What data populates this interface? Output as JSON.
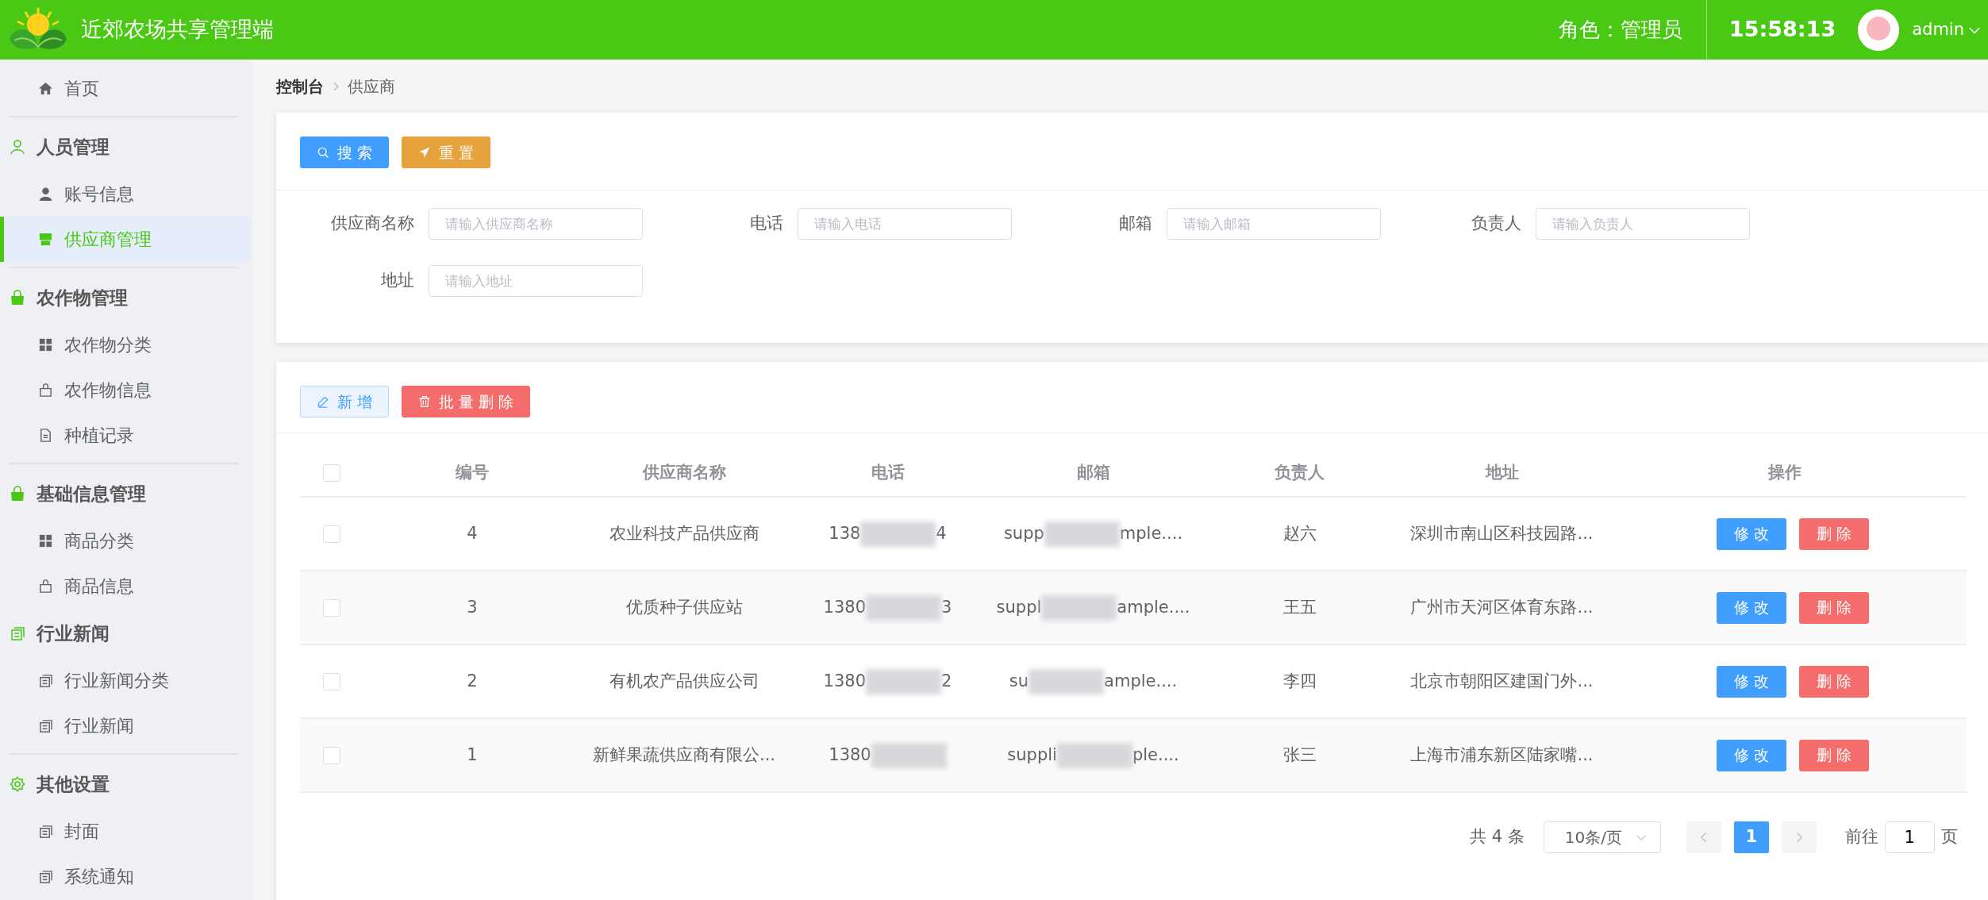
{
  "header": {
    "title": "近郊农场共享管理端",
    "role": "角色：管理员",
    "time": "15:58:13",
    "user": "admin"
  },
  "sidebar": {
    "entries": [
      {
        "kind": "link",
        "label": "首页",
        "selected": false
      },
      {
        "kind": "divider"
      },
      {
        "kind": "group",
        "label": "人员管理"
      },
      {
        "kind": "link",
        "label": "账号信息",
        "selected": false
      },
      {
        "kind": "link",
        "label": "供应商管理",
        "selected": true
      },
      {
        "kind": "divider"
      },
      {
        "kind": "group",
        "label": "农作物管理"
      },
      {
        "kind": "link",
        "label": "农作物分类",
        "selected": false
      },
      {
        "kind": "link",
        "label": "农作物信息",
        "selected": false
      },
      {
        "kind": "link",
        "label": "种植记录",
        "selected": false
      },
      {
        "kind": "divider"
      },
      {
        "kind": "group",
        "label": "基础信息管理"
      },
      {
        "kind": "link",
        "label": "商品分类",
        "selected": false
      },
      {
        "kind": "link",
        "label": "商品信息",
        "selected": false
      },
      {
        "kind": "group",
        "label": "行业新闻"
      },
      {
        "kind": "link",
        "label": "行业新闻分类",
        "selected": false
      },
      {
        "kind": "link",
        "label": "行业新闻",
        "selected": false
      },
      {
        "kind": "divider"
      },
      {
        "kind": "group",
        "label": "其他设置"
      },
      {
        "kind": "link",
        "label": "封面",
        "selected": false
      },
      {
        "kind": "link",
        "label": "系统通知",
        "selected": false
      }
    ]
  },
  "breadcrumb": [
    "控制台",
    "供应商"
  ],
  "search_buttons": [
    "搜 索",
    "重 置"
  ],
  "filters": [
    {
      "label": "供应商名称",
      "placeholder": "请输入供应商名称"
    },
    {
      "label": "电话",
      "placeholder": "请输入电话"
    },
    {
      "label": "邮箱",
      "placeholder": "请输入邮箱"
    },
    {
      "label": "负责人",
      "placeholder": "请输入负责人"
    },
    {
      "label": "地址",
      "placeholder": "请输入地址"
    }
  ],
  "table_buttons": [
    "新 增",
    "批 量 删 除"
  ],
  "table": {
    "select_all": {
      "checked": false
    },
    "columns": [
      "编号",
      "供应商名称",
      "电话",
      "邮箱",
      "负责人",
      "地址",
      "操作"
    ],
    "rows": [
      {
        "checked": false,
        "id": "4",
        "name": "农业科技产品供应商",
        "phone": {
          "head": "138",
          "tail": "4"
        },
        "email": {
          "head": "supp",
          "tail": "mple...."
        },
        "contact": "赵六",
        "address": "深圳市南山区科技园路...",
        "actions": [
          "修 改",
          "删 除"
        ]
      },
      {
        "checked": false,
        "id": "3",
        "name": "优质种子供应站",
        "phone": {
          "head": "1380",
          "tail": "3"
        },
        "email": {
          "head": "suppl",
          "tail": "ample...."
        },
        "contact": "王五",
        "address": "广州市天河区体育东路...",
        "actions": [
          "修 改",
          "删 除"
        ]
      },
      {
        "checked": false,
        "id": "2",
        "name": "有机农产品供应公司",
        "phone": {
          "head": "1380",
          "tail": "2"
        },
        "email": {
          "head": "su",
          "tail": "ample...."
        },
        "contact": "李四",
        "address": "北京市朝阳区建国门外...",
        "actions": [
          "修 改",
          "删 除"
        ]
      },
      {
        "checked": false,
        "id": "1",
        "name": "新鲜果蔬供应商有限公...",
        "phone": {
          "head": "1380"
        },
        "email": {
          "head": "suppli",
          "tail": "ple...."
        },
        "contact": "张三",
        "address": "上海市浦东新区陆家嘴...",
        "actions": [
          "修 改",
          "删 除"
        ]
      }
    ]
  },
  "pagination": {
    "total": "共 4 条",
    "page_size": "10条/页",
    "pages": [
      {
        "label": "1",
        "selected": true
      }
    ],
    "goto_label": "前往",
    "goto_value": "1",
    "goto_suffix": "页"
  }
}
